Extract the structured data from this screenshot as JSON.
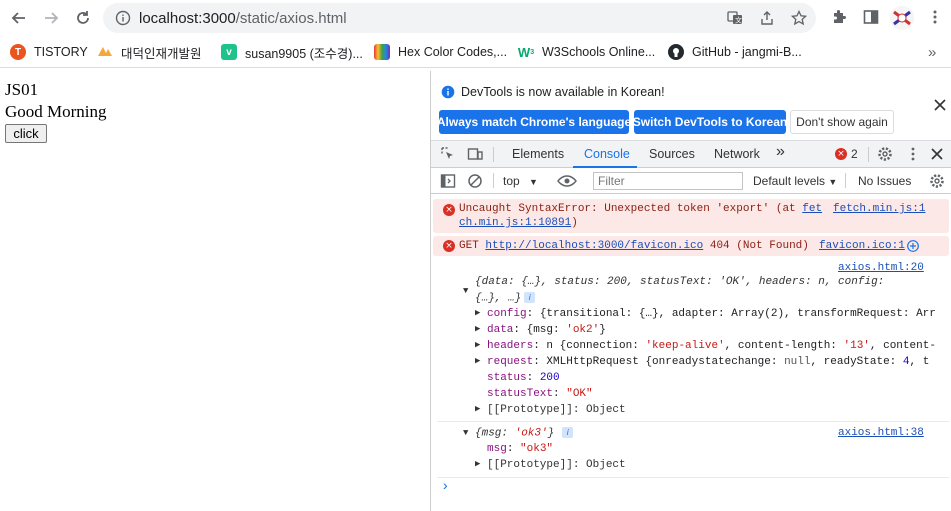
{
  "browser": {
    "url_host": "localhost:3000",
    "url_path": "/static/axios.html"
  },
  "bookmarks": [
    {
      "label": "TISTORY",
      "color": "#eb531f"
    },
    {
      "label": "대덕인재개발원",
      "color": "#f4a73a"
    },
    {
      "label": "susan9905 (조수경)...",
      "color": "#1ec28b"
    },
    {
      "label": "Hex Color Codes,...",
      "color": "#6b4fd6"
    },
    {
      "label": "W3Schools Online...",
      "color": "#04aa6d"
    },
    {
      "label": "GitHub - jangmi-B...",
      "color": "#24292f"
    }
  ],
  "page": {
    "line1": "JS01",
    "line2": "Good Morning",
    "button": "click"
  },
  "devtools": {
    "infobar": {
      "message": "DevTools is now available in Korean!",
      "btn_match": "Always match Chrome's language",
      "btn_switch": "Switch DevTools to Korean",
      "btn_dont": "Don't show again"
    },
    "tabs": [
      "Elements",
      "Console",
      "Sources",
      "Network"
    ],
    "more_tabs": "»",
    "error_count": "2",
    "filterbar": {
      "context": "top",
      "filter_placeholder": "Filter",
      "levels": "Default levels",
      "issues": "No Issues"
    },
    "console": {
      "err1": {
        "text": "Uncaught SyntaxError: Unexpected token 'export' (at ",
        "link1": "fet",
        "link_right": "fetch.min.js:1",
        "line2_link": "ch.min.js:1:10891",
        "line2_end": ")"
      },
      "err2": {
        "prefix": "GET ",
        "url": "http://localhost:3000/favicon.ico",
        "status": " 404 (Not Found)",
        "source": "favicon.ico:1"
      },
      "log1": {
        "source": "axios.html:20",
        "summary1": "{data: {…}, status: 200, statusText: 'OK', headers: n, config:",
        "summary2": "{…}, …}",
        "config_key": "config",
        "config_val": "{transitional: {…}, adapter: Array(2), transformRequest: Arr",
        "data_key": "data",
        "data_val_pre": "{msg: ",
        "data_val_str": "'ok2'",
        "data_val_post": "}",
        "headers_key": "headers",
        "headers_val_pre": "n {connection: ",
        "headers_val_str": "'keep-alive'",
        "headers_val_post": ", content-length: ",
        "headers_val_str2": "'13'",
        "headers_val_tail": ", content-",
        "request_key": "request",
        "request_val_pre": "XMLHttpRequest {onreadystatechange: ",
        "request_val_null": "null",
        "request_val_mid": ", readyState: ",
        "request_val_num": "4",
        "request_val_tail": ", t",
        "status_key": "status",
        "status_val": "200",
        "statustext_key": "statusText",
        "statustext_val": "\"OK\"",
        "proto": "[[Prototype]]: Object"
      },
      "log2": {
        "source": "axios.html:38",
        "summary_pre": "{msg: ",
        "summary_str": "'ok3'",
        "summary_post": "}",
        "msg_key": "msg",
        "msg_val": "\"ok3\"",
        "proto": "[[Prototype]]: Object"
      },
      "prompt": "›"
    }
  }
}
